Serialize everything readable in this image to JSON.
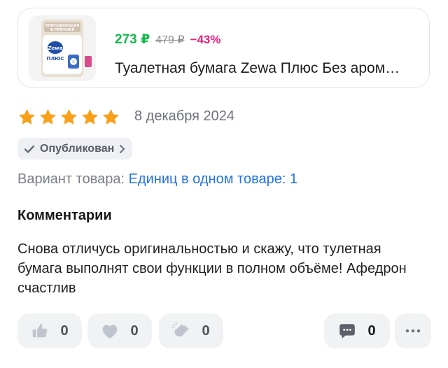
{
  "product": {
    "price": "273 ₽",
    "old_price": "479 ₽",
    "discount": "−43%",
    "title": "Туалетная бумага Zewa Плюс Без аром…",
    "thumb_badge": "ВПИТЫВАЮЩАЯ И ПРОЧНАЯ",
    "thumb_brand": "Zewa",
    "thumb_name": "ПЛЮС"
  },
  "review": {
    "rating": 5,
    "rating_max": 5,
    "date": "8 декабря 2024",
    "status": "Опубликован",
    "variant_label": "Вариант товара:",
    "variant_value": "Единиц в одном товаре: 1",
    "comments_heading": "Комментарии",
    "comment_text": "Снова отличусь оригинальностью и скажу, что тулетная бумага выполнят свои функции в полном объёме! Афедрон счастлив"
  },
  "reactions": {
    "like_count": "0",
    "heart_count": "0",
    "clap_count": "0",
    "comments_count": "0"
  },
  "colors": {
    "price": "#11b84a",
    "discount": "#e5227f",
    "star": "#f9a01b",
    "link": "#2372e6"
  },
  "icons": [
    "product-image",
    "star-icon",
    "check-icon",
    "chevron-right-icon",
    "thumbs-up-icon",
    "heart-icon",
    "clap-icon",
    "comment-icon",
    "more-icon"
  ]
}
